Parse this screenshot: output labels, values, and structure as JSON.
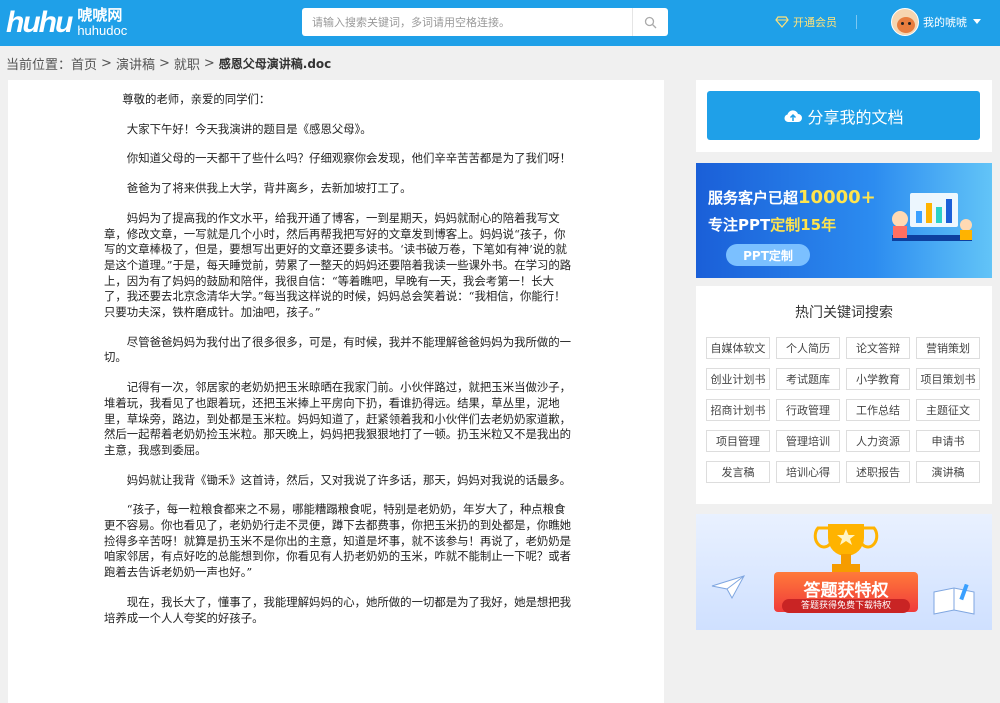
{
  "header": {
    "logo_mark": "huhu",
    "logo_cn": "唬唬网",
    "logo_en": "huhudoc",
    "search_placeholder": "请输入搜索关键词，多词请用空格连接。",
    "vip_label": "开通会员",
    "user_label": "我的唬唬",
    "brand_color": "#1fa0e8"
  },
  "breadcrumb": {
    "prefix": "当前位置：",
    "items": [
      "首页",
      "演讲稿",
      "就职",
      "感恩父母演讲稿.doc"
    ]
  },
  "article": {
    "paragraphs": [
      "尊敬的老师，亲爱的同学们：",
      "大家下午好！今天我演讲的题目是《感恩父母》。",
      "你知道父母的一天都干了些什么吗？仔细观察你会发现，他们辛辛苦苦都是为了我们呀！",
      "爸爸为了将来供我上大学，背井离乡，去新加坡打工了。",
      "妈妈为了提高我的作文水平，给我开通了博客，一到星期天，妈妈就耐心的陪着我写文章，修改文章，一写就是几个小时，然后再帮我把写好的文章发到博客上。妈妈说“孩子，你写的文章棒极了，但是，要想写出更好的文章还要多读书。‘读书破万卷，下笔如有神’说的就是这个道理。”于是，每天睡觉前，劳累了一整天的妈妈还要陪着我读一些课外书。在学习的路上，因为有了妈妈的鼓励和陪伴，我很自信：“等着瞧吧，早晚有一天，我会考第一！长大了，我还要去北京念清华大学。”每当我这样说的时候，妈妈总会笑着说：“我相信，你能行！只要功夫深，铁杵磨成针。加油吧，孩子。”",
      "尽管爸爸妈妈为我付出了很多很多，可是，有时候，我并不能理解爸爸妈妈为我所做的一切。",
      "记得有一次，邻居家的老奶奶把玉米晾晒在我家门前。小伙伴路过，就把玉米当做沙子，堆着玩，我看见了也跟着玩，还把玉米捧上平房向下扔，看谁扔得远。结果，草丛里，泥地里，草垛旁，路边，到处都是玉米粒。妈妈知道了，赶紧领着我和小伙伴们去老奶奶家道歉，然后一起帮着老奶奶捡玉米粒。那天晚上，妈妈把我狠狠地打了一顿。扔玉米粒又不是我出的主意，我感到委屈。",
      "妈妈就让我背《锄禾》这首诗，然后，又对我说了许多话，那天，妈妈对我说的话最多。",
      "“孩子，每一粒粮食都来之不易，哪能糟蹋粮食呢，特别是老奶奶，年岁大了，种点粮食更不容易。你也看见了，老奶奶行走不灵便，蹲下去都费事，你把玉米扔的到处都是，你瞧她捡得多辛苦呀！就算是扔玉米不是你出的主意，知道是坏事，就不该参与！再说了，老奶奶是咱家邻居，有点好吃的总能想到你，你看见有人扔老奶奶的玉米，咋就不能制止一下呢？或者跑着去告诉老奶奶一声也好。”",
      "现在，我长大了，懂事了，我能理解妈妈的心，她所做的一切都是为了我好，她是想把我培养成一个人人夸奖的好孩子。"
    ]
  },
  "sidebar": {
    "share_label": "分享我的文档",
    "ad1": {
      "line1_pre": "服务客户已超",
      "line1_num": "10000+",
      "line2_pre": "专注PPT",
      "line2_hl": "定制15年",
      "button": "PPT定制"
    },
    "keywords_title": "热门关键词搜索",
    "keywords": [
      "自媒体软文",
      "个人简历",
      "论文答辩",
      "营销策划",
      "创业计划书",
      "考试题库",
      "小学教育",
      "项目策划书",
      "招商计划书",
      "行政管理",
      "工作总结",
      "主题征文",
      "项目管理",
      "管理培训",
      "人力资源",
      "申请书",
      "发言稿",
      "培训心得",
      "述职报告",
      "演讲稿"
    ],
    "ad2": {
      "title": "答题获特权",
      "subtitle": "答题获得免费下载特权"
    }
  }
}
